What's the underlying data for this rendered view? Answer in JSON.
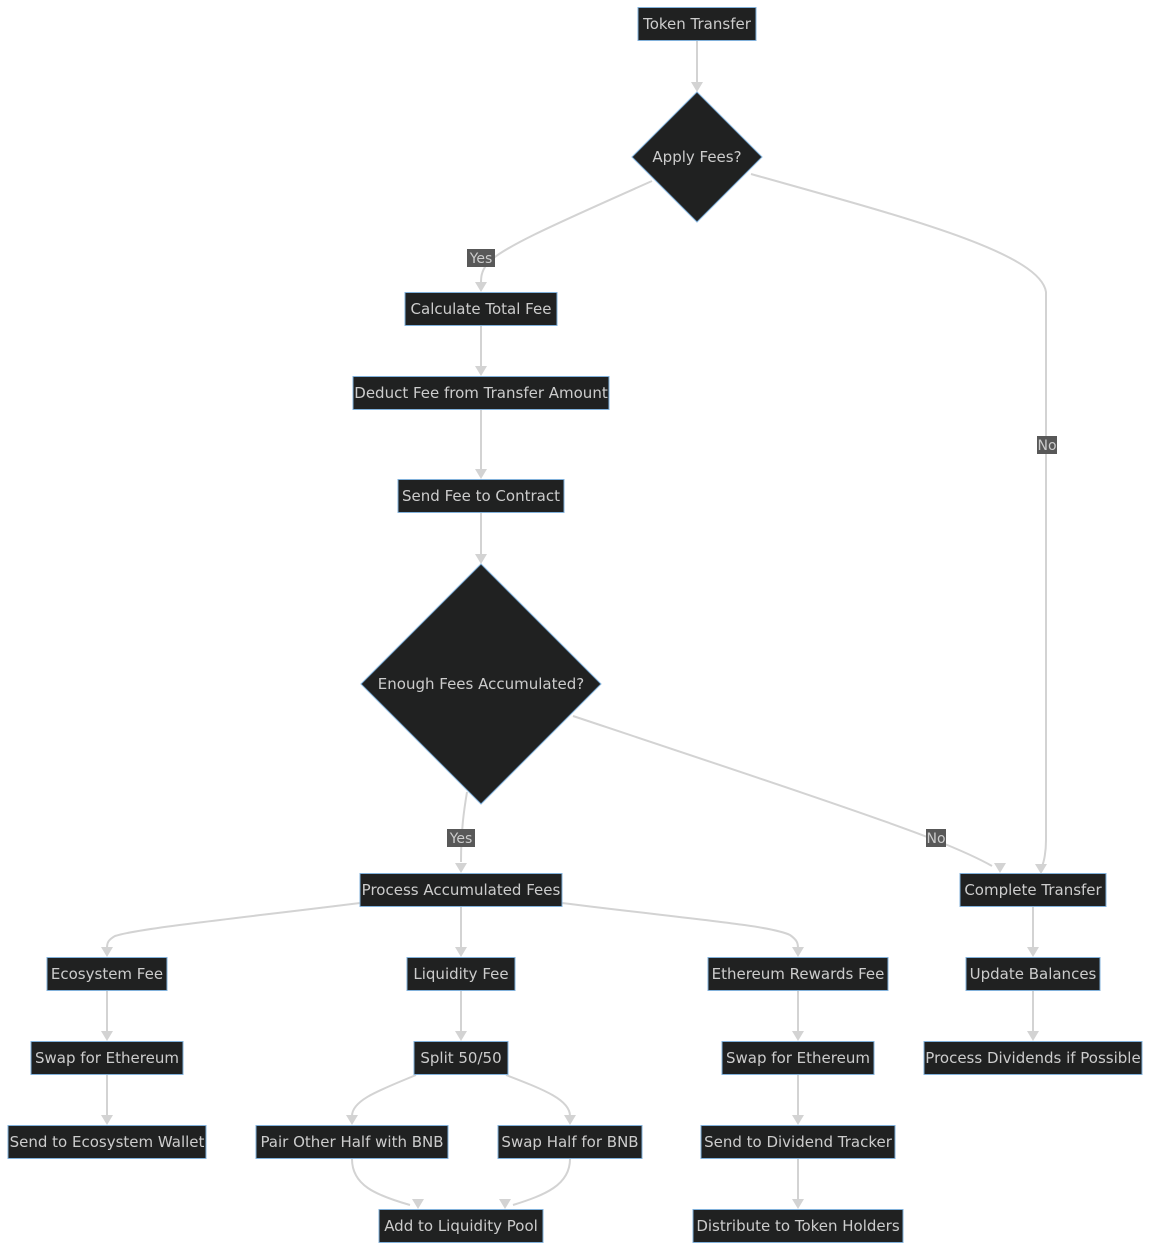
{
  "diagram": {
    "type": "flowchart",
    "direction": "top-down",
    "colors": {
      "node_fill": "#202121",
      "node_border": "#81B1DB",
      "node_text": "#cccccc",
      "edge": "#d3d3d3",
      "edge_label_bg": "#585858"
    },
    "nodes": [
      {
        "id": "A",
        "label": "Token Transfer",
        "shape": "rect"
      },
      {
        "id": "B",
        "label": "Apply Fees?",
        "shape": "diamond"
      },
      {
        "id": "C",
        "label": "Calculate Total Fee",
        "shape": "rect"
      },
      {
        "id": "D",
        "label": "Deduct Fee from Transfer Amount",
        "shape": "rect"
      },
      {
        "id": "E",
        "label": "Send Fee to Contract",
        "shape": "rect"
      },
      {
        "id": "F",
        "label": "Enough Fees Accumulated?",
        "shape": "diamond"
      },
      {
        "id": "G",
        "label": "Process Accumulated Fees",
        "shape": "rect"
      },
      {
        "id": "H",
        "label": "Complete Transfer",
        "shape": "rect"
      },
      {
        "id": "I",
        "label": "Ecosystem Fee",
        "shape": "rect"
      },
      {
        "id": "J",
        "label": "Liquidity Fee",
        "shape": "rect"
      },
      {
        "id": "K",
        "label": "Ethereum Rewards Fee",
        "shape": "rect"
      },
      {
        "id": "L",
        "label": "Update Balances",
        "shape": "rect"
      },
      {
        "id": "M",
        "label": "Swap for Ethereum",
        "shape": "rect"
      },
      {
        "id": "N",
        "label": "Split 50/50",
        "shape": "rect"
      },
      {
        "id": "O",
        "label": "Swap for Ethereum",
        "shape": "rect"
      },
      {
        "id": "P",
        "label": "Process Dividends if Possible",
        "shape": "rect"
      },
      {
        "id": "Q",
        "label": "Send to Ecosystem Wallet",
        "shape": "rect"
      },
      {
        "id": "R",
        "label": "Pair Other Half with BNB",
        "shape": "rect"
      },
      {
        "id": "S",
        "label": "Swap Half for BNB",
        "shape": "rect"
      },
      {
        "id": "T",
        "label": "Send to Dividend Tracker",
        "shape": "rect"
      },
      {
        "id": "U",
        "label": "Add to Liquidity Pool",
        "shape": "rect"
      },
      {
        "id": "V",
        "label": "Distribute to Token Holders",
        "shape": "rect"
      }
    ],
    "edges": [
      {
        "from": "A",
        "to": "B",
        "label": ""
      },
      {
        "from": "B",
        "to": "C",
        "label": "Yes"
      },
      {
        "from": "B",
        "to": "H",
        "label": "No"
      },
      {
        "from": "C",
        "to": "D",
        "label": ""
      },
      {
        "from": "D",
        "to": "E",
        "label": ""
      },
      {
        "from": "E",
        "to": "F",
        "label": ""
      },
      {
        "from": "F",
        "to": "G",
        "label": "Yes"
      },
      {
        "from": "F",
        "to": "H",
        "label": "No"
      },
      {
        "from": "G",
        "to": "I",
        "label": ""
      },
      {
        "from": "G",
        "to": "J",
        "label": ""
      },
      {
        "from": "G",
        "to": "K",
        "label": ""
      },
      {
        "from": "H",
        "to": "L",
        "label": ""
      },
      {
        "from": "I",
        "to": "M",
        "label": ""
      },
      {
        "from": "J",
        "to": "N",
        "label": ""
      },
      {
        "from": "K",
        "to": "O",
        "label": ""
      },
      {
        "from": "L",
        "to": "P",
        "label": ""
      },
      {
        "from": "M",
        "to": "Q",
        "label": ""
      },
      {
        "from": "N",
        "to": "R",
        "label": ""
      },
      {
        "from": "N",
        "to": "S",
        "label": ""
      },
      {
        "from": "O",
        "to": "T",
        "label": ""
      },
      {
        "from": "R",
        "to": "U",
        "label": ""
      },
      {
        "from": "S",
        "to": "U",
        "label": ""
      },
      {
        "from": "T",
        "to": "V",
        "label": ""
      }
    ]
  }
}
